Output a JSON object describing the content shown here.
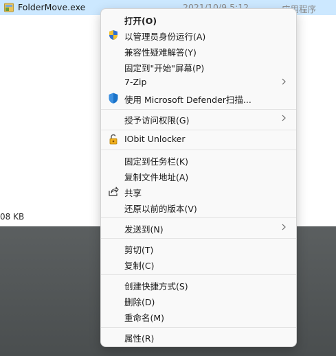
{
  "file": {
    "name": "FolderMove.exe",
    "date": "2021/10/9 5:12",
    "type": "应用程序",
    "size_text": "08 KB"
  },
  "menu": {
    "open": "打开(O)",
    "run_as_admin": "以管理员身份运行(A)",
    "troubleshoot": "兼容性疑难解答(Y)",
    "pin_start": "固定到\"开始\"屏幕(P)",
    "zip": "7-Zip",
    "defender": "使用 Microsoft Defender扫描...",
    "grant_access": "授予访问权限(G)",
    "iobit": "IObit Unlocker",
    "pin_taskbar": "固定到任务栏(K)",
    "copy_path": "复制文件地址(A)",
    "share": "共享",
    "restore": "还原以前的版本(V)",
    "send_to": "发送到(N)",
    "cut": "剪切(T)",
    "copy": "复制(C)",
    "create_shortcut": "创建快捷方式(S)",
    "delete": "删除(D)",
    "rename": "重命名(M)",
    "properties": "属性(R)"
  },
  "icons": {
    "file": "exe-file-icon",
    "uac": "uac-shield-icon",
    "defender": "defender-shield-icon",
    "iobit": "iobit-lock-icon",
    "share": "share-icon",
    "submenu": "chevron-right-icon"
  },
  "colors": {
    "selection": "#cce8ff",
    "menu_bg": "#f9f9f9",
    "defender_blue": "#1a73c9"
  }
}
